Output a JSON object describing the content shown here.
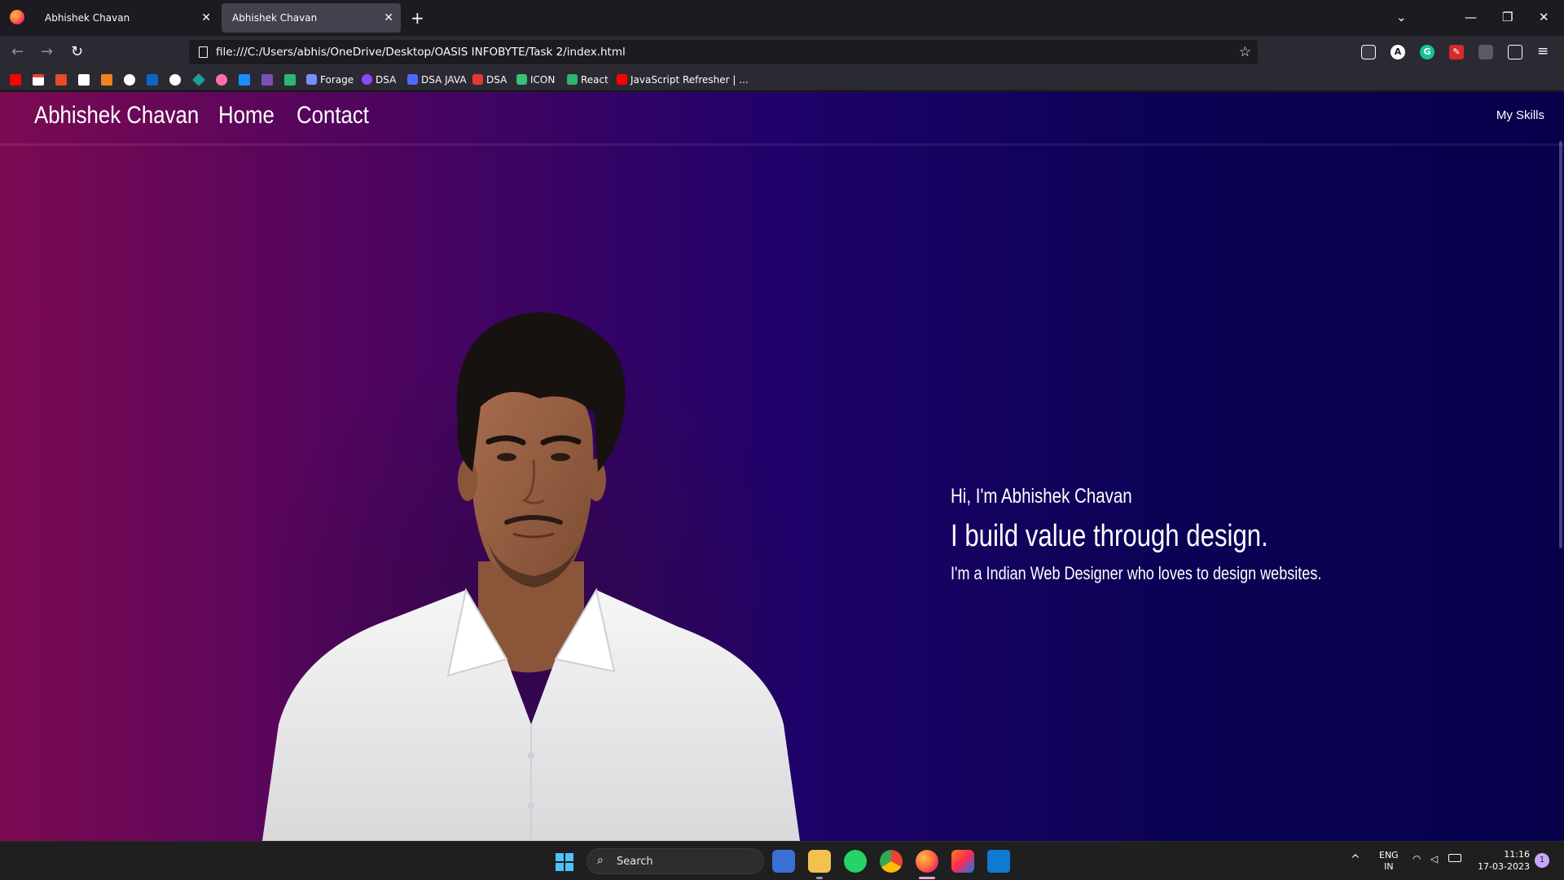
{
  "browser": {
    "tabs": [
      {
        "title": "Abhishek Chavan",
        "active": false
      },
      {
        "title": "Abhishek Chavan",
        "active": true
      }
    ],
    "url": "file:///C:/Users/abhis/OneDrive/Desktop/OASIS INFOBYTE/Task 2/index.html",
    "bookmarks": [
      {
        "label": "Forage"
      },
      {
        "label": "DSA"
      },
      {
        "label": "DSA JAVA"
      },
      {
        "label": "DSA"
      },
      {
        "label": "ICON"
      },
      {
        "label": "React"
      },
      {
        "label": "JavaScript Refresher | ..."
      }
    ]
  },
  "site": {
    "brand": "Abhishek Chavan",
    "nav": [
      "Home",
      "Contact"
    ],
    "skills_link": "My Skills",
    "hero": {
      "greeting": "Hi, I'm Abhishek Chavan",
      "tagline": "I build value through design.",
      "subtitle": "I'm a Indian Web Designer who loves to design websites."
    },
    "colors": {
      "gradient_left": "#7c0a52",
      "gradient_mid": "#1f026a",
      "gradient_right": "#07014c"
    }
  },
  "taskbar": {
    "search_label": "Search",
    "language": "ENG",
    "region": "IN",
    "time": "11:16",
    "date": "17-03-2023",
    "notification_count": "1"
  }
}
